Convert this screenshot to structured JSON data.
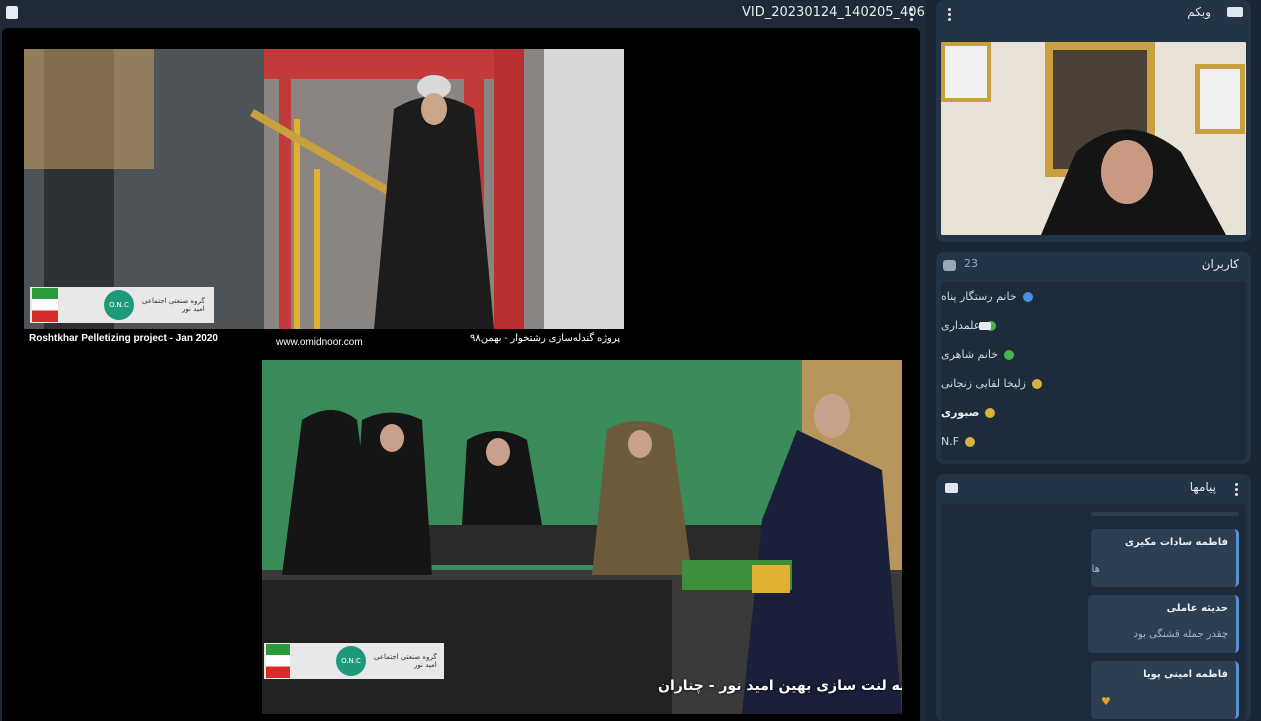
{
  "main": {
    "title": "VID_20230124_140205_406",
    "video_top": {
      "caption_left": "Roshtkhar Pelletizing project - Jan 2020",
      "caption_center": "www.omidnoor.com",
      "caption_right": "پروژه گندله‌سازی رشتخوار - بهمن۹۸",
      "logo_line1": "گروه صنعتی اجتماعی",
      "logo_line2": "امید نور",
      "logo_badge": "O.N.C"
    },
    "video_bottom": {
      "caption": "کارخانه لنت سازی بهین امید نور - چناران",
      "logo_line1": "گروه صنعتی اجتماعی",
      "logo_line2": "امید نور",
      "logo_badge": "O.N.C"
    }
  },
  "webcam": {
    "title": "وبکم",
    "icon": "camera-icon"
  },
  "users": {
    "title": "کاربران",
    "count": "23",
    "items": [
      {
        "name": "خانم رستگار پناه",
        "color": "#4a8fe0"
      },
      {
        "name": "علمداری",
        "color": "#4bb34b"
      },
      {
        "name": "خانم شاهری",
        "color": "#4bb34b"
      },
      {
        "name": "زلیخا لقایی زنجانی",
        "color": "#d4b43c"
      },
      {
        "name": "صبوری",
        "color": "#d4b43c"
      },
      {
        "name": "N.F",
        "color": "#d4b43c"
      }
    ]
  },
  "messages": {
    "title": "پیامها",
    "items": [
      {
        "name": "فاطمه سادات مکیری",
        "text": "ها"
      },
      {
        "name": "حدیثه عاملی",
        "text": "چقدر جمله قشنگی بود"
      },
      {
        "name": "فاطمه امینی پویا",
        "text": ""
      }
    ]
  }
}
